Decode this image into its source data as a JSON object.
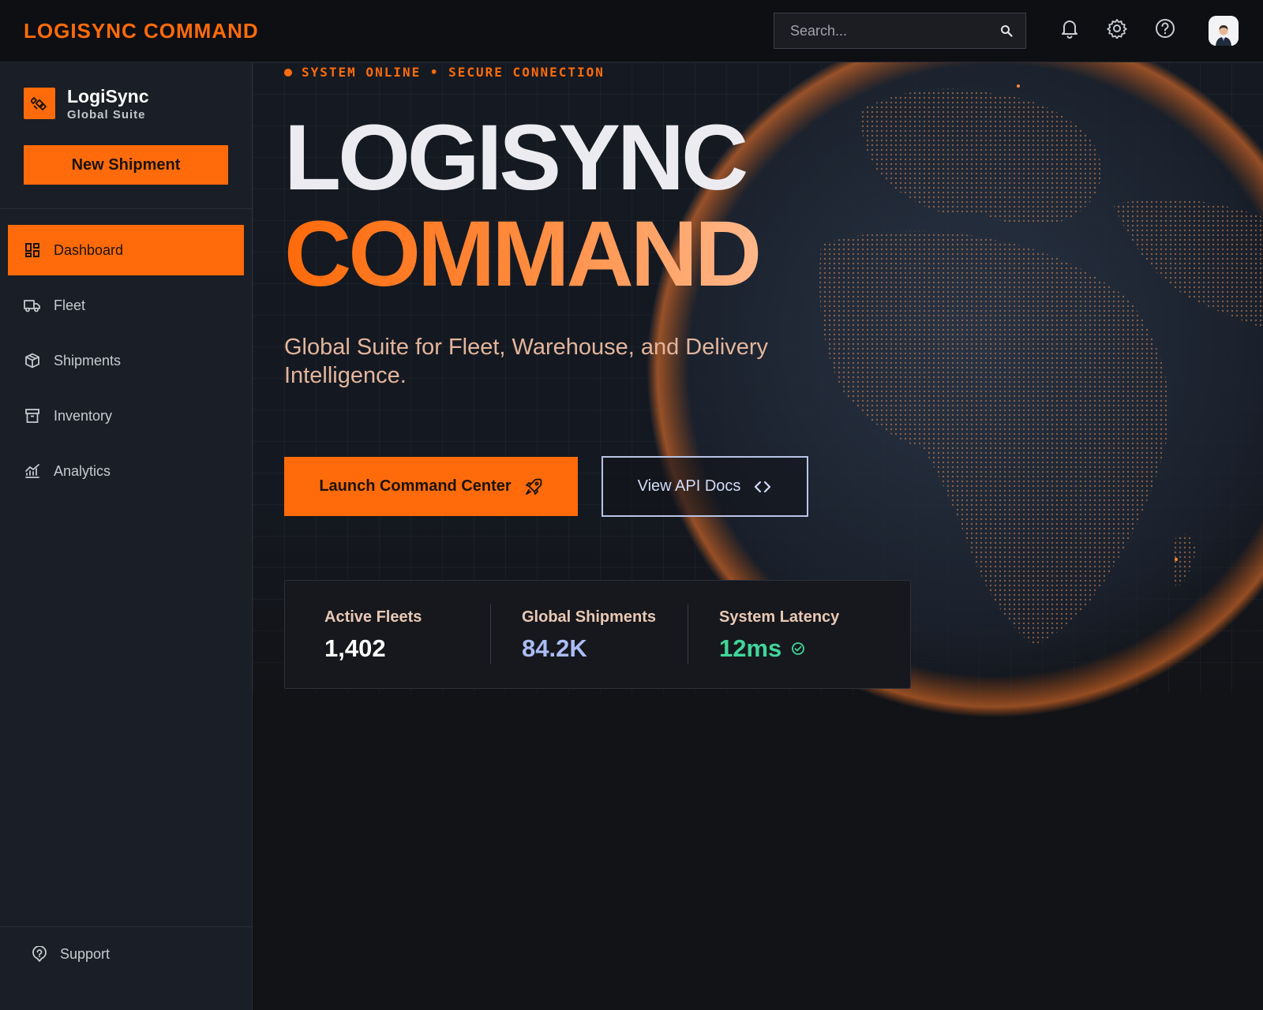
{
  "topbar": {
    "brand": "LOGISYNC COMMAND",
    "search_placeholder": "Search..."
  },
  "icons": {
    "search": "search-icon",
    "notifications": "bell-icon",
    "settings": "gear-icon",
    "help": "help-circle-icon",
    "avatar": "user-avatar"
  },
  "sidebar": {
    "logo_name": "LogiSync",
    "logo_sub": "Global Suite",
    "new_shipment_label": "New Shipment",
    "items": [
      {
        "label": "Dashboard",
        "icon": "dashboard-icon",
        "active": true
      },
      {
        "label": "Fleet",
        "icon": "truck-icon",
        "active": false
      },
      {
        "label": "Shipments",
        "icon": "package-icon",
        "active": false
      },
      {
        "label": "Inventory",
        "icon": "archive-icon",
        "active": false
      },
      {
        "label": "Analytics",
        "icon": "analytics-icon",
        "active": false
      }
    ],
    "support_label": "Support"
  },
  "hero": {
    "status": "SYSTEM ONLINE • SECURE CONNECTION",
    "title_line1": "LOGISYNC",
    "title_line2": "COMMAND",
    "subtitle": "Global Suite for Fleet, Warehouse, and Delivery Intelligence.",
    "launch_label": "Launch Command Center",
    "api_label": "View API Docs"
  },
  "stats": [
    {
      "label": "Active Fleets",
      "value": "1,402",
      "color": "#ffffff"
    },
    {
      "label": "Global Shipments",
      "value": "84.2K",
      "color": "#aabdf5"
    },
    {
      "label": "System Latency",
      "value": "12ms",
      "color": "#3fd69a"
    }
  ],
  "colors": {
    "accent": "#ff6b0a",
    "sidebar_bg": "#1a1e26",
    "topbar_bg": "#0e0f12",
    "success": "#3fd69a"
  }
}
